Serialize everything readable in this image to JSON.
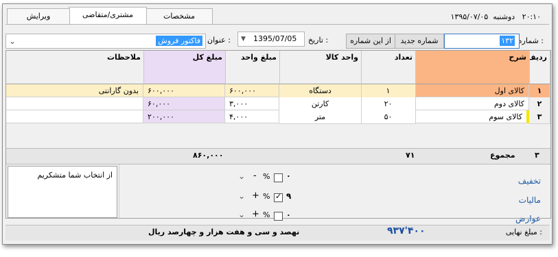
{
  "datetime": {
    "time": "۲۰:۱۰",
    "day": "دوشنبه",
    "date": "۱۳۹۵/۰۷/۰۵"
  },
  "tabs": [
    {
      "label": "مشخصات"
    },
    {
      "label": "مشتری/متقاضی"
    },
    {
      "label": "ویرایش"
    }
  ],
  "header": {
    "number_label": "شماره :",
    "number_value": "۱۳۲",
    "new_number_button": "شماره جدید",
    "from_number_button": "از این شماره",
    "date_label": "تاریخ :",
    "date_value": "1395/07/05",
    "title_label": "عنوان :",
    "title_value": "فاکتور فروش"
  },
  "columns": [
    "ردیف",
    "شرح",
    "تعداد",
    "واحد کالا",
    "مبلغ واحد",
    "مبلغ کل",
    "ملاحظات"
  ],
  "rows": [
    {
      "idx": "۱",
      "desc": "کالای اول",
      "qty": "۱",
      "unit": "دستگاه",
      "unit_price": "۶۰۰,۰۰۰",
      "total": "۶۰۰,۰۰۰",
      "note": "بدون گارانتی"
    },
    {
      "idx": "۲",
      "desc": "کالای دوم",
      "qty": "۲۰",
      "unit": "کارتن",
      "unit_price": "۳,۰۰۰",
      "total": "۶۰,۰۰۰",
      "note": ""
    },
    {
      "idx": "۳",
      "desc": "کالای سوم",
      "qty": "۵۰",
      "unit": "متر",
      "unit_price": "۴,۰۰۰",
      "total": "۲۰۰,۰۰۰",
      "note": ""
    }
  ],
  "summary": {
    "row_count": "۳",
    "label": "مجموع",
    "qty_total": "۷۱",
    "amount_total": "۸۶۰,۰۰۰"
  },
  "notes_text": "از انتخاب شما متشکریم",
  "adjustments": [
    {
      "label": "تخفیف",
      "value": "۰",
      "checked": false,
      "sign": "-"
    },
    {
      "label": "مالیات",
      "value": "۹",
      "checked": true,
      "sign": "+"
    },
    {
      "label": "عوارض",
      "value": "۰",
      "checked": false,
      "sign": "+"
    }
  ],
  "percent_symbol": "%",
  "final": {
    "label": "مبلغ نهایی :",
    "amount": "۹۳۷'۴۰۰",
    "words": "نهصد و سی و هفت هزار و چهارصد ریال"
  },
  "colors": {
    "highlight_header": "#fbb584",
    "total_col": "#eadcf4",
    "selected_row": "#fdf0c6"
  }
}
